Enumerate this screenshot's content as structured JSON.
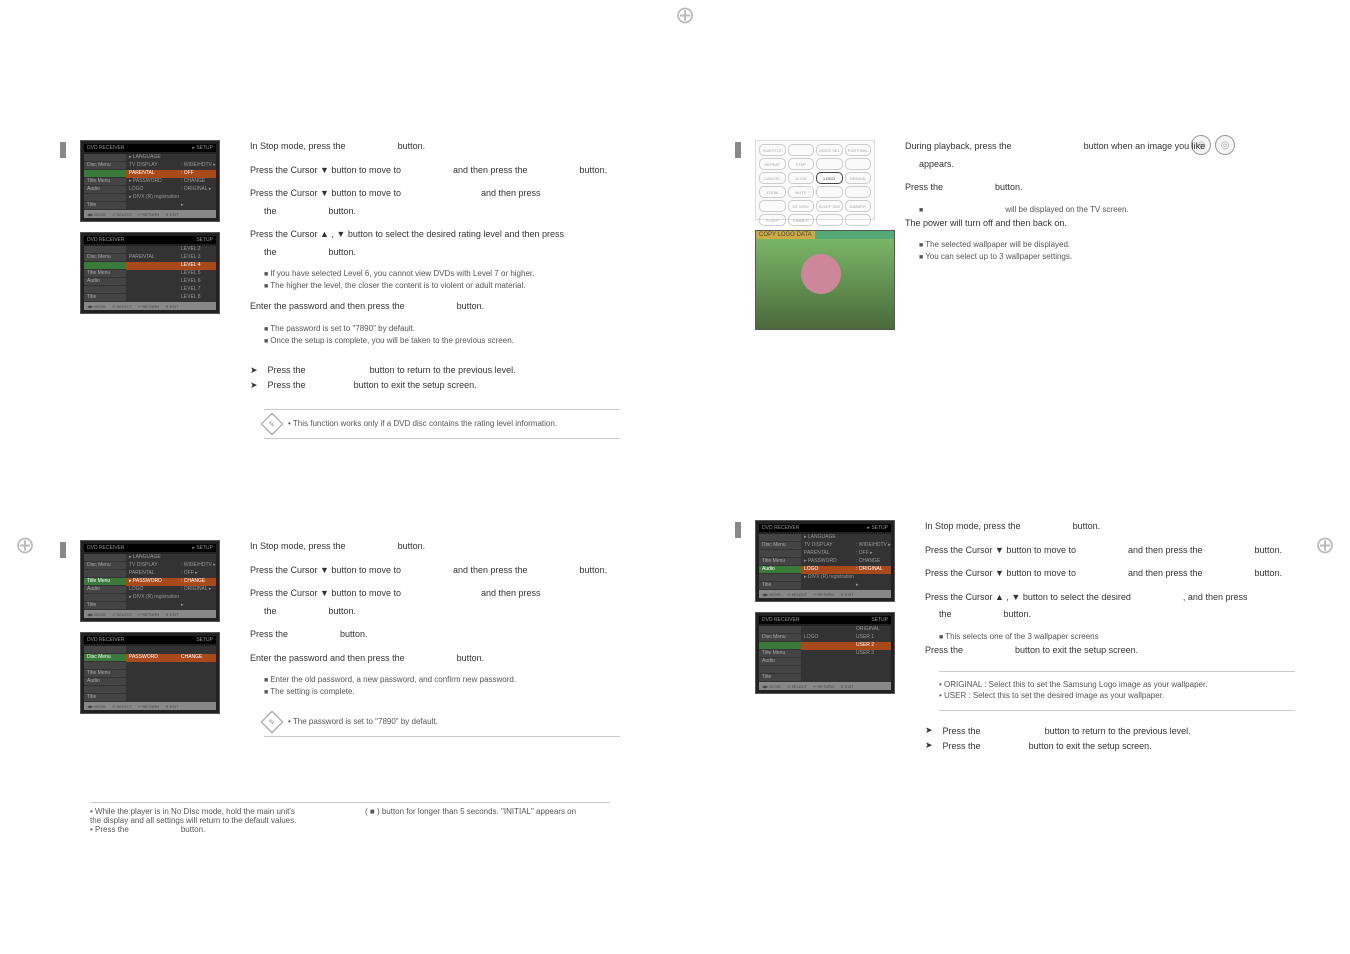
{
  "icons": [
    "◎",
    "◎"
  ],
  "thumbs": {
    "main": {
      "header_left": "DVD RECEIVER",
      "header_right": "▸ SETUP",
      "rows": [
        {
          "left": "",
          "mid": "▸ LANGUAGE",
          "right": ""
        },
        {
          "left": "Disc Menu",
          "mid": "  TV DISPLAY",
          "right": ": WIDE/HDTV  ▸"
        },
        {
          "left": "",
          "mid": "  PARENTAL",
          "right": ": OFF",
          "hl": true
        },
        {
          "left": "Title Menu",
          "mid": "▸ PASSWORD",
          "right": ": CHANGE"
        },
        {
          "left": "Audio",
          "mid": "  LOGO",
          "right": ": ORIGINAL  ▸"
        },
        {
          "left": "",
          "mid": "▸ DIVX (R) registration",
          "right": ""
        },
        {
          "left": "Title",
          "mid": "",
          "right": "▸"
        }
      ],
      "footer": [
        "◀▶ MOVE",
        "⏎ SELECT",
        "↩ RETURN",
        "✕ EXIT"
      ]
    },
    "level": {
      "header_left": "DVD RECEIVER",
      "header_right": "SETUP",
      "rows": [
        {
          "left": "",
          "mid": "",
          "right": "LEVEL 2"
        },
        {
          "left": "Disc Menu",
          "mid": "PARENTAL",
          "right": "LEVEL 3"
        },
        {
          "left": "",
          "mid": "",
          "right": "LEVEL 4",
          "hl": true
        },
        {
          "left": "Title Menu",
          "mid": "",
          "right": "LEVEL 5"
        },
        {
          "left": "Audio",
          "mid": "",
          "right": "LEVEL 6"
        },
        {
          "left": "",
          "mid": "",
          "right": "LEVEL 7"
        },
        {
          "left": "Title",
          "mid": "",
          "right": "LEVEL 8"
        }
      ],
      "footer": [
        "◀▶ MOVE",
        "⏎ SELECT",
        "↩ RETURN",
        "✕ EXIT"
      ]
    },
    "pass_main": {
      "header_left": "DVD RECEIVER",
      "header_right": "▸ SETUP",
      "rows": [
        {
          "left": "",
          "mid": "▸ LANGUAGE",
          "right": ""
        },
        {
          "left": "Disc Menu",
          "mid": "  TV DISPLAY",
          "right": ": WIDE/HDTV  ▸"
        },
        {
          "left": "",
          "mid": "  PARENTAL",
          "right": ": OFF  ▸"
        },
        {
          "left": "Title Menu",
          "mid": "▸ PASSWORD",
          "right": ": CHANGE",
          "hl": true
        },
        {
          "left": "Audio",
          "mid": "  LOGO",
          "right": ": ORIGINAL  ▸"
        },
        {
          "left": "",
          "mid": "▸ DIVX (R) registration",
          "right": ""
        },
        {
          "left": "Title",
          "mid": "",
          "right": "▸"
        }
      ],
      "footer": [
        "◀▶ MOVE",
        "⏎ SELECT",
        "↩ RETURN",
        "✕ EXIT"
      ]
    },
    "pass_change": {
      "header_left": "DVD RECEIVER",
      "header_right": "SETUP",
      "rows": [
        {
          "left": "",
          "mid": "",
          "right": ""
        },
        {
          "left": "Disc Menu",
          "mid": "PASSWORD",
          "right": "CHANGE",
          "hl": true
        },
        {
          "left": "",
          "mid": "",
          "right": ""
        },
        {
          "left": "Title Menu",
          "mid": "",
          "right": ""
        },
        {
          "left": "Audio",
          "mid": "",
          "right": ""
        },
        {
          "left": "",
          "mid": "",
          "right": ""
        },
        {
          "left": "Title",
          "mid": "",
          "right": ""
        }
      ],
      "footer": [
        "◀▶ MOVE",
        "⏎ SELECT",
        "↩ RETURN",
        "✕ EXIT"
      ]
    },
    "logo_main": {
      "header_left": "DVD RECEIVER",
      "header_right": "▸ SETUP",
      "rows": [
        {
          "left": "",
          "mid": "▸ LANGUAGE",
          "right": ""
        },
        {
          "left": "Disc Menu",
          "mid": "  TV DISPLAY",
          "right": ": WIDE/HDTV  ▸"
        },
        {
          "left": "",
          "mid": "  PARENTAL",
          "right": ": OFF  ▸"
        },
        {
          "left": "Title Menu",
          "mid": "▸ PASSWORD",
          "right": ": CHANGE"
        },
        {
          "left": "Audio",
          "mid": "  LOGO",
          "right": ": ORIGINAL",
          "hl": true
        },
        {
          "left": "",
          "mid": "▸ DIVX (R) registration",
          "right": ""
        },
        {
          "left": "Title",
          "mid": "",
          "right": "▸"
        }
      ],
      "footer": [
        "◀▶ MOVE",
        "⏎ SELECT",
        "↩ RETURN",
        "✕ EXIT"
      ]
    },
    "logo_sel": {
      "header_left": "DVD RECEIVER",
      "header_right": "SETUP",
      "rows": [
        {
          "left": "",
          "mid": "",
          "right": "ORIGINAL"
        },
        {
          "left": "Disc Menu",
          "mid": "LOGO",
          "right": "USER 1"
        },
        {
          "left": "",
          "mid": "",
          "right": "USER 2",
          "hl": true
        },
        {
          "left": "Title Menu",
          "mid": "",
          "right": "USER 3"
        },
        {
          "left": "Audio",
          "mid": "",
          "right": ""
        },
        {
          "left": "",
          "mid": "",
          "right": ""
        },
        {
          "left": "Title",
          "mid": "",
          "right": ""
        }
      ],
      "footer": [
        "◀▶ MOVE",
        "⏎ SELECT",
        "↩ RETURN",
        "✕ EXIT"
      ]
    },
    "photo_tag": "COPY LOGO DATA",
    "remote_buttons": [
      "SUBTITLE",
      "",
      "VIDEO SEL",
      "PORT/XML",
      "REPEAT",
      "STEP",
      "",
      "",
      "CANCEL",
      "SLOW",
      "LOGO",
      "REMAIN",
      "ZOOM",
      "MUTE",
      "",
      "",
      "",
      "EZ VIEW",
      "SLEEP DIM",
      "DIMMER",
      "SLEEP",
      "DIMMER",
      "",
      ""
    ]
  },
  "left": {
    "rating": {
      "s1_a": "In Stop mode, press the",
      "s1_b": "button.",
      "s2_a": "Press the Cursor ▼ button to move to",
      "s2_b": "and then press the",
      "s2_c": "button.",
      "s3_a": "Press the Cursor ▼ button to move to",
      "s3_b": "and then press",
      "s3_c": "the",
      "s3_d": "button.",
      "s4": "Press the Cursor ▲ , ▼ button to select the desired rating level and then press",
      "s4b_a": "the",
      "s4b_b": "button.",
      "b4a": "If you have selected Level 6, you cannot view DVDs with Level 7 or higher.",
      "b4b": "The higher the level, the closer the content is to violent or adult material.",
      "s5_a": "Enter the password and then press the",
      "s5_b": "button.",
      "b5a": "The password is set to \"7890\" by default.",
      "b5b": "Once the setup is complete, you will be taken to the previous screen.",
      "p1_a": "Press the",
      "p1_b": "button to return to the previous level.",
      "p2_a": "Press the",
      "p2_b": "button to exit the setup screen.",
      "note": "This function works only if a DVD disc contains the rating level information."
    },
    "password": {
      "s1_a": "In Stop mode, press the",
      "s1_b": "button.",
      "s2_a": "Press the Cursor ▼ button to move to",
      "s2_b": "and then press the",
      "s2_c": "button.",
      "s3_a": "Press the Cursor ▼ button to move to",
      "s3_b": "and then press",
      "s3_c": "the",
      "s3_d": "button.",
      "s4_a": "Press the",
      "s4_b": "button.",
      "s5_a": "Enter the password and then press the",
      "s5_b": "button.",
      "b5a": "Enter the old password, a new password, and confirm new password.",
      "b5b": "The setting is complete.",
      "note": "The password is set to \"7890\" by default."
    }
  },
  "right": {
    "wallpaper": {
      "s1_a": "During playback, press the",
      "s1_b": "button when an image you like",
      "s1_c": "appears.",
      "s2_a": "Press the",
      "s2_b": "button.",
      "b2": "will be displayed on the TV screen.",
      "s3": "The power will turn off and then back on.",
      "b3a": "The selected wallpaper will be displayed.",
      "b3b": "You can select up to 3 wallpaper settings."
    },
    "logo": {
      "s1_a": "In Stop mode, press the",
      "s1_b": "button.",
      "s2_a": "Press the Cursor ▼ button to move to",
      "s2_b": "and then press the",
      "s2_c": "button.",
      "s3_a": "Press the Cursor ▼ button to move to",
      "s3_b": "and then press the",
      "s3_c": "button.",
      "s4_a": "Press the Cursor ▲ , ▼ button to select the desired",
      "s4_b": ", and then press",
      "s4_c": "the",
      "s4_d": "button.",
      "b4": "This selects one of the 3 wallpaper screens",
      "s5_a": "Press the",
      "s5_b": "button to exit the setup screen.",
      "info1": "ORIGINAL : Select this to set the Samsung Logo image as your wallpaper.",
      "info2": "USER : Select this to set the desired image as your wallpaper.",
      "p1_a": "Press the",
      "p1_b": "button to return to the previous level.",
      "p2_a": "Press the",
      "p2_b": "button to exit the setup screen."
    }
  },
  "footer": {
    "line1": "• While the player is in No DIsc mode, hold the main unit's",
    "line1b": "( ■ ) button for longer than 5 seconds. \"INITIAL\" appears on",
    "line2": "  the display and all settings will return to the default values.",
    "line3_a": "• Press the",
    "line3_b": "button."
  }
}
